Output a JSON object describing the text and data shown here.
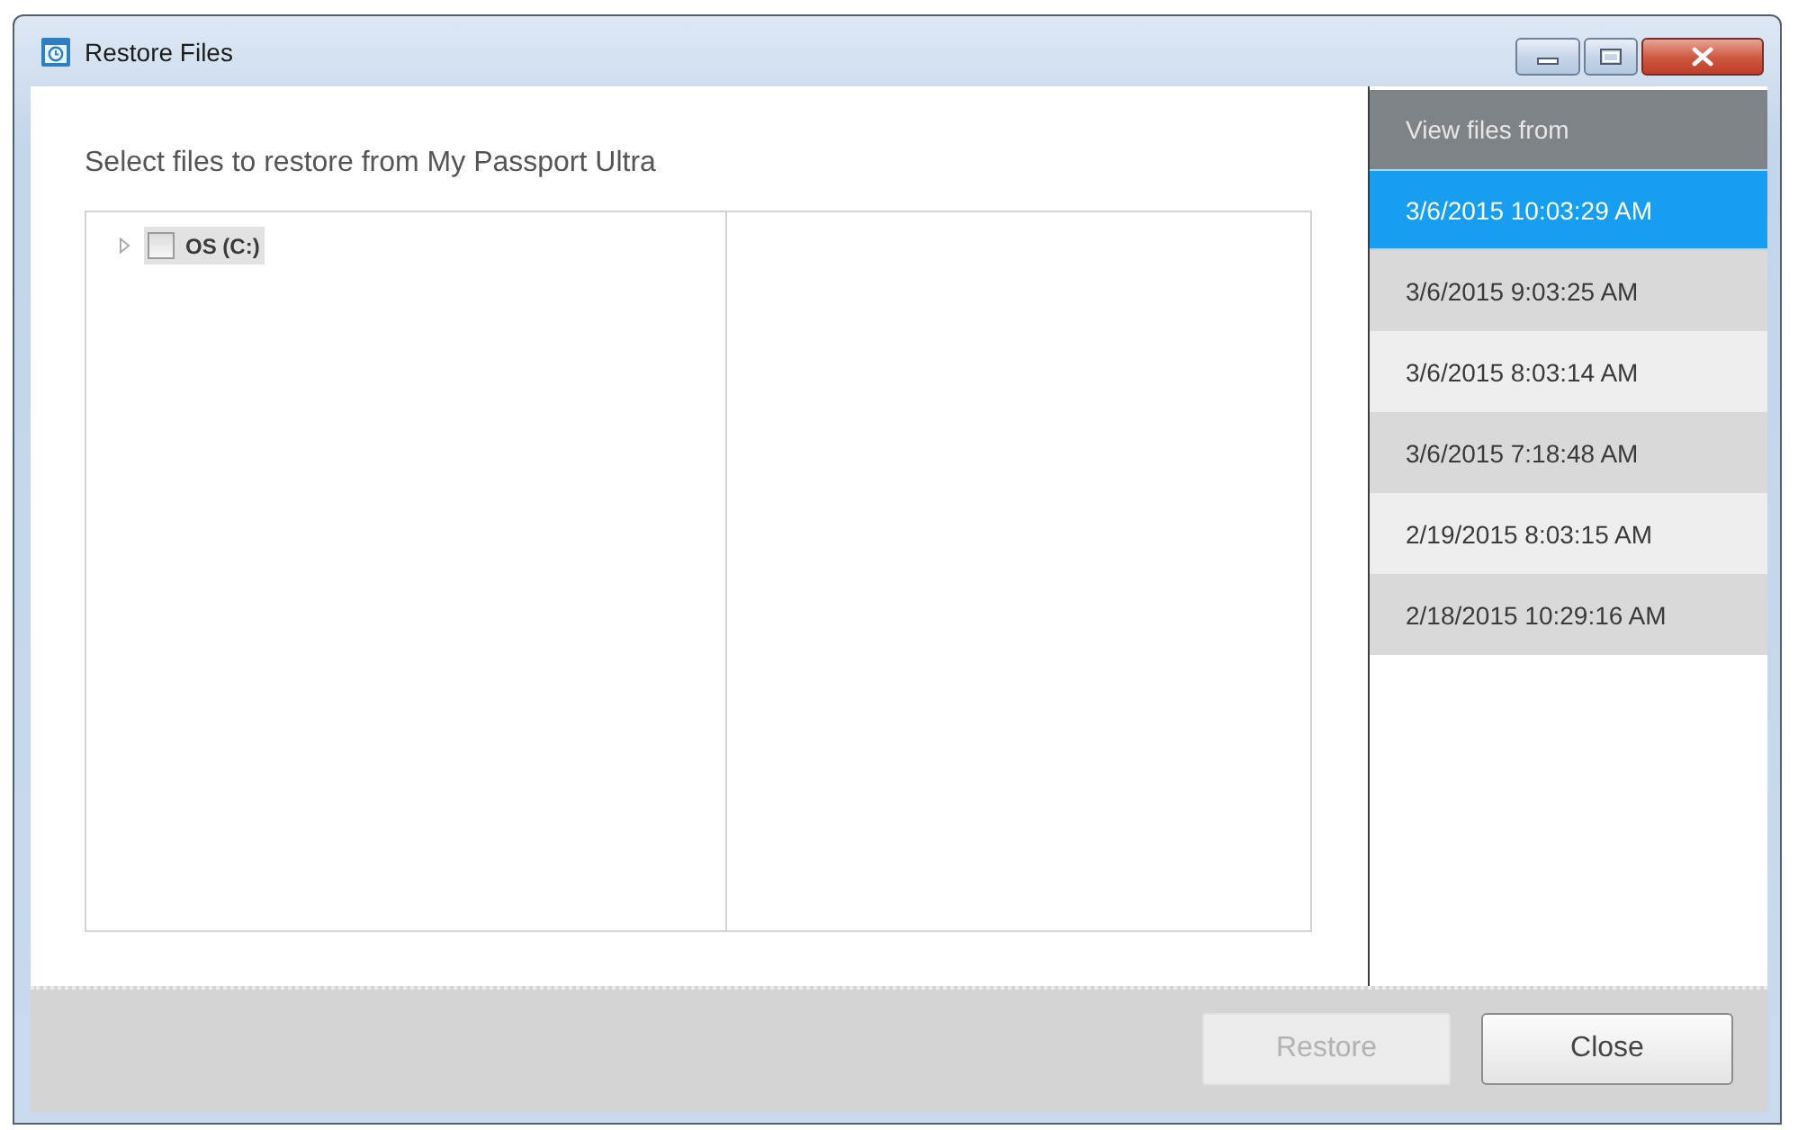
{
  "window": {
    "title": "Restore Files"
  },
  "heading": "Select files to restore from My Passport Ultra",
  "tree": [
    {
      "label": "OS (C:)",
      "expanded": false,
      "checked": false,
      "selected": true
    }
  ],
  "versions": {
    "header": "View files from",
    "items": [
      {
        "label": "3/6/2015 10:03:29 AM",
        "selected": true
      },
      {
        "label": "3/6/2015 9:03:25 AM",
        "selected": false
      },
      {
        "label": "3/6/2015 8:03:14 AM",
        "selected": false
      },
      {
        "label": "3/6/2015 7:18:48 AM",
        "selected": false
      },
      {
        "label": "2/19/2015 8:03:15 AM",
        "selected": false
      },
      {
        "label": "2/18/2015 10:29:16 AM",
        "selected": false
      }
    ]
  },
  "buttons": [
    {
      "label": "Restore",
      "disabled": true
    },
    {
      "label": "Close",
      "disabled": false
    }
  ]
}
